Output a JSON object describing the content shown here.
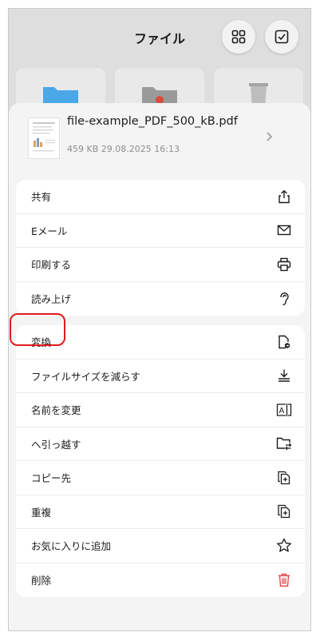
{
  "header": {
    "title": "ファイル"
  },
  "file": {
    "name": "file-example_PDF_500_kB.pdf",
    "size": "459 KB",
    "date": "29.08.2025 16:13"
  },
  "groups": [
    [
      {
        "label": "共有",
        "icon": "share-icon"
      },
      {
        "label": "Eメール",
        "icon": "envelope-icon"
      },
      {
        "label": "印刷する",
        "icon": "printer-icon"
      },
      {
        "label": "読み上げ",
        "icon": "ear-icon"
      }
    ],
    [
      {
        "label": "変換",
        "icon": "convert-document-icon"
      },
      {
        "label": "ファイルサイズを減らす",
        "icon": "reduce-size-icon"
      },
      {
        "label": "名前を変更",
        "icon": "rename-icon"
      },
      {
        "label": "へ引っ越す",
        "icon": "move-folder-icon"
      },
      {
        "label": "コピー先",
        "icon": "copy-icon"
      },
      {
        "label": "重複",
        "icon": "duplicate-icon"
      },
      {
        "label": "お気に入りに追加",
        "icon": "star-icon"
      },
      {
        "label": "削除",
        "icon": "trash-icon"
      }
    ]
  ],
  "colors": {
    "accent": "#1c1c1e",
    "delete": "#e5484d",
    "highlight": "#e41b1b",
    "folder": "#4aa8e8"
  }
}
